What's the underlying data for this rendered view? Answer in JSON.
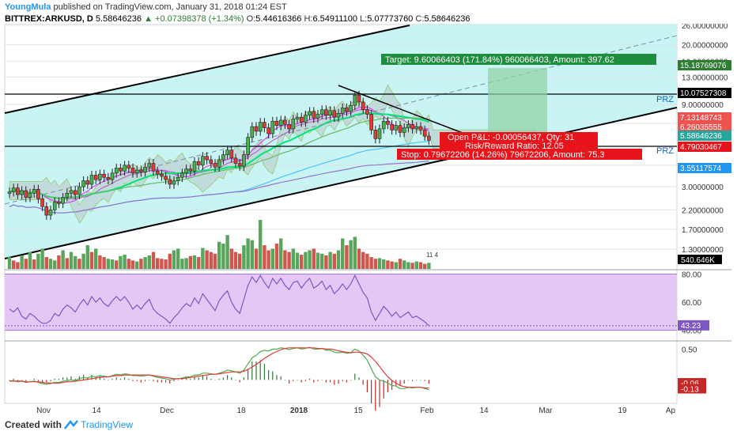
{
  "header": {
    "author": "YoungMula",
    "published": "published on TradingView.com, January 31, 2018 01:24 EST",
    "symbol": "BITTREX:ARKUSD, D",
    "last": "5.58646236",
    "change": "▲ +0.07398378 (+1.34%)",
    "o_label": "O:",
    "o_val": "5.44616366",
    "h_label": "H:",
    "h_val": "6.54911100",
    "l_label": "L:",
    "l_val": "5.07773760",
    "c_label": "C:",
    "c_val": "5.58646236"
  },
  "footer": {
    "created": "Created with",
    "brand": "TradingView"
  },
  "colors": {
    "up": "#26a69a",
    "down": "#ef5350",
    "channel_fill": "#c8f4f4",
    "vol_up": "#58a55c",
    "vol_down": "#d0574e",
    "rsi_fill": "#e4c7f5",
    "rsi_line": "#7e57c2",
    "macd_line": "#4caf50",
    "signal_line": "#e53935",
    "target": "#1e8e3e",
    "stop": "#e8141b"
  },
  "chart_data": [
    {
      "type": "candlestick",
      "name": "ARKUSD price",
      "scale": "log",
      "x_ticks": [
        "Nov",
        "14",
        "Dec",
        "18",
        "2018",
        "15",
        "Feb",
        "14",
        "Mar",
        "19",
        "Ap"
      ],
      "y_ticks": [
        "26.00000000",
        "20.00000000",
        "16.00000000",
        "13.00000000",
        "9.00000000",
        "7.00000000",
        "4.00000000",
        "3.00000000",
        "2.20000000",
        "1.70000000",
        "1.30000000"
      ],
      "ylim": [
        1.0,
        26.5
      ],
      "closes": [
        2.8,
        2.95,
        2.7,
        2.85,
        2.6,
        2.75,
        2.9,
        2.55,
        2.3,
        2.05,
        2.2,
        2.45,
        2.4,
        2.6,
        2.75,
        2.85,
        2.7,
        3.0,
        3.25,
        3.1,
        3.5,
        3.3,
        3.55,
        3.4,
        3.3,
        3.6,
        3.85,
        3.7,
        4.0,
        3.85,
        3.6,
        3.75,
        3.65,
        3.9,
        4.1,
        3.7,
        3.55,
        3.45,
        3.3,
        3.1,
        3.25,
        3.4,
        3.6,
        3.8,
        3.7,
        4.2,
        4.0,
        4.5,
        4.3,
        4.1,
        3.9,
        4.3,
        4.6,
        4.9,
        4.4,
        4.1,
        3.95,
        4.6,
        5.8,
        6.7,
        6.3,
        7.1,
        6.6,
        6.1,
        7.2,
        6.8,
        7.3,
        6.9,
        6.5,
        7.4,
        7.6,
        7.1,
        7.8,
        8.2,
        7.5,
        7.9,
        8.4,
        7.8,
        8.3,
        7.6,
        8.0,
        8.6,
        8.2,
        8.9,
        10.2,
        9.3,
        8.4,
        7.9,
        6.4,
        5.7,
        6.5,
        7.2,
        6.9,
        6.4,
        6.8,
        6.2,
        6.6,
        6.9,
        6.5,
        6.7,
        6.4,
        5.9,
        5.58
      ],
      "price_labels": [
        {
          "text": "15.18769076",
          "color": "#2e7d32"
        },
        {
          "text": "10.07527308",
          "color": "#000000"
        },
        {
          "text": "7.13148743",
          "color": "#ef5350"
        },
        {
          "text": "6.26035555",
          "color": "#ef5350"
        },
        {
          "text": "5.58646236",
          "color": "#26a69a"
        },
        {
          "text": "4.79030467",
          "color": "#e8141b"
        },
        {
          "text": "3.55117574",
          "color": "#2196f3"
        }
      ],
      "annotations": {
        "prz": "PRZ",
        "target": "Target: 9.60066403 (171.84%) 960066403, Amount: 397.62",
        "open_pl": "Open P&L: -0.00056437, Qty: 31",
        "rr": "Risk/Reward Ratio: 12.05",
        "stop": "Stop: 0.79672206 (14.26%) 79672206, Amount: 75.3"
      }
    },
    {
      "type": "bar",
      "name": "Volume",
      "last_label": "540.646K",
      "events_label": "11 4",
      "values": [
        0.35,
        0.25,
        0.2,
        0.4,
        0.3,
        0.5,
        0.28,
        0.45,
        0.6,
        0.35,
        0.3,
        0.25,
        0.4,
        0.55,
        0.32,
        0.5,
        0.38,
        0.3,
        0.45,
        0.7,
        0.5,
        0.6,
        0.4,
        0.35,
        0.3,
        0.28,
        0.25,
        0.38,
        0.42,
        0.3,
        0.25,
        0.22,
        0.3,
        0.35,
        0.4,
        0.5,
        0.32,
        0.3,
        0.28,
        0.45,
        0.55,
        0.6,
        0.3,
        0.32,
        0.38,
        0.4,
        0.35,
        0.62,
        0.55,
        0.5,
        0.45,
        0.8,
        0.75,
        1.0,
        0.6,
        0.5,
        0.45,
        0.7,
        0.9,
        0.85,
        0.6,
        1.45,
        0.7,
        0.55,
        0.6,
        0.75,
        0.9,
        0.55,
        0.5,
        0.6,
        0.48,
        0.42,
        0.5,
        0.55,
        0.6,
        0.48,
        0.45,
        0.4,
        0.5,
        0.45,
        0.55,
        0.9,
        0.7,
        0.85,
        0.95,
        0.6,
        0.5,
        0.45,
        0.35,
        0.3,
        0.32,
        0.28,
        0.25,
        0.22,
        0.2,
        0.3,
        0.25,
        0.2,
        0.18,
        0.22,
        0.2,
        0.15,
        0.18
      ],
      "up": [
        1,
        0,
        0,
        1,
        0,
        1,
        0,
        1,
        1,
        0,
        1,
        1,
        0,
        1,
        0,
        1,
        1,
        0,
        1,
        1,
        0,
        1,
        0,
        0,
        1,
        1,
        0,
        1,
        1,
        0,
        0,
        1,
        0,
        1,
        1,
        0,
        0,
        0,
        0,
        0,
        1,
        1,
        1,
        1,
        0,
        1,
        0,
        1,
        0,
        0,
        0,
        1,
        1,
        1,
        0,
        0,
        0,
        1,
        1,
        1,
        0,
        1,
        0,
        0,
        1,
        0,
        1,
        0,
        0,
        1,
        1,
        0,
        1,
        1,
        0,
        1,
        1,
        0,
        1,
        0,
        1,
        1,
        0,
        1,
        1,
        0,
        0,
        0,
        0,
        0,
        1,
        1,
        0,
        0,
        1,
        0,
        1,
        1,
        0,
        1,
        0,
        0,
        1
      ]
    },
    {
      "type": "line",
      "name": "RSI",
      "y_ticks": [
        "80.00",
        "60.00",
        "40.00"
      ],
      "current": "43.23",
      "ylim": [
        33,
        82
      ],
      "values": [
        55,
        53,
        56,
        50,
        48,
        52,
        50,
        47,
        45,
        45,
        47,
        52,
        50,
        55,
        58,
        56,
        53,
        58,
        62,
        58,
        64,
        60,
        63,
        59,
        57,
        61,
        64,
        61,
        64,
        60,
        55,
        58,
        55,
        59,
        62,
        55,
        52,
        50,
        48,
        45,
        49,
        52,
        56,
        59,
        57,
        63,
        59,
        66,
        62,
        58,
        54,
        61,
        65,
        68,
        60,
        55,
        52,
        62,
        72,
        78,
        74,
        79,
        74,
        70,
        77,
        73,
        77,
        72,
        69,
        74,
        75,
        70,
        74,
        77,
        70,
        72,
        75,
        69,
        72,
        66,
        69,
        73,
        69,
        73,
        79,
        73,
        67,
        63,
        53,
        47,
        52,
        57,
        54,
        50,
        53,
        49,
        51,
        53,
        49,
        50,
        48,
        46,
        43.23
      ]
    },
    {
      "type": "line",
      "name": "MACD",
      "y_ticks": [
        "0.50"
      ],
      "macd_label": "-0.06",
      "signal_label": "-0.13",
      "ylim": [
        -0.38,
        0.62
      ],
      "macd": [
        -0.02,
        -0.01,
        -0.03,
        -0.02,
        -0.04,
        -0.03,
        -0.02,
        -0.04,
        -0.06,
        -0.07,
        -0.06,
        -0.04,
        -0.04,
        -0.02,
        -0.01,
        0.0,
        -0.01,
        0.02,
        0.04,
        0.03,
        0.06,
        0.05,
        0.07,
        0.06,
        0.05,
        0.07,
        0.09,
        0.08,
        0.1,
        0.09,
        0.07,
        0.07,
        0.06,
        0.07,
        0.08,
        0.06,
        0.04,
        0.03,
        0.02,
        0.0,
        0.01,
        0.02,
        0.03,
        0.05,
        0.05,
        0.08,
        0.08,
        0.11,
        0.11,
        0.1,
        0.09,
        0.11,
        0.13,
        0.16,
        0.15,
        0.13,
        0.11,
        0.16,
        0.26,
        0.36,
        0.4,
        0.46,
        0.48,
        0.47,
        0.5,
        0.5,
        0.52,
        0.51,
        0.49,
        0.51,
        0.52,
        0.5,
        0.51,
        0.53,
        0.5,
        0.5,
        0.51,
        0.48,
        0.48,
        0.45,
        0.44,
        0.45,
        0.43,
        0.44,
        0.5,
        0.47,
        0.4,
        0.32,
        0.18,
        0.05,
        0.0,
        -0.02,
        -0.05,
        -0.09,
        -0.1,
        -0.14,
        -0.14,
        -0.12,
        -0.13,
        -0.12,
        -0.12,
        -0.14,
        -0.16
      ],
      "signal": [
        -0.02,
        -0.02,
        -0.02,
        -0.02,
        -0.03,
        -0.03,
        -0.03,
        -0.03,
        -0.04,
        -0.05,
        -0.05,
        -0.05,
        -0.05,
        -0.04,
        -0.03,
        -0.03,
        -0.02,
        -0.01,
        0.0,
        0.01,
        0.02,
        0.03,
        0.04,
        0.05,
        0.05,
        0.06,
        0.07,
        0.07,
        0.08,
        0.08,
        0.08,
        0.08,
        0.08,
        0.08,
        0.08,
        0.07,
        0.06,
        0.05,
        0.04,
        0.03,
        0.02,
        0.02,
        0.02,
        0.03,
        0.04,
        0.05,
        0.06,
        0.07,
        0.08,
        0.09,
        0.09,
        0.1,
        0.11,
        0.12,
        0.13,
        0.13,
        0.13,
        0.14,
        0.17,
        0.21,
        0.25,
        0.3,
        0.35,
        0.39,
        0.43,
        0.46,
        0.49,
        0.51,
        0.52,
        0.52,
        0.52,
        0.52,
        0.52,
        0.52,
        0.52,
        0.51,
        0.51,
        0.5,
        0.5,
        0.49,
        0.47,
        0.46,
        0.45,
        0.44,
        0.45,
        0.45,
        0.44,
        0.42,
        0.37,
        0.3,
        0.22,
        0.13,
        0.05,
        -0.01,
        -0.05,
        -0.09,
        -0.11,
        -0.12,
        -0.12,
        -0.12,
        -0.12,
        -0.13,
        -0.13
      ]
    }
  ]
}
